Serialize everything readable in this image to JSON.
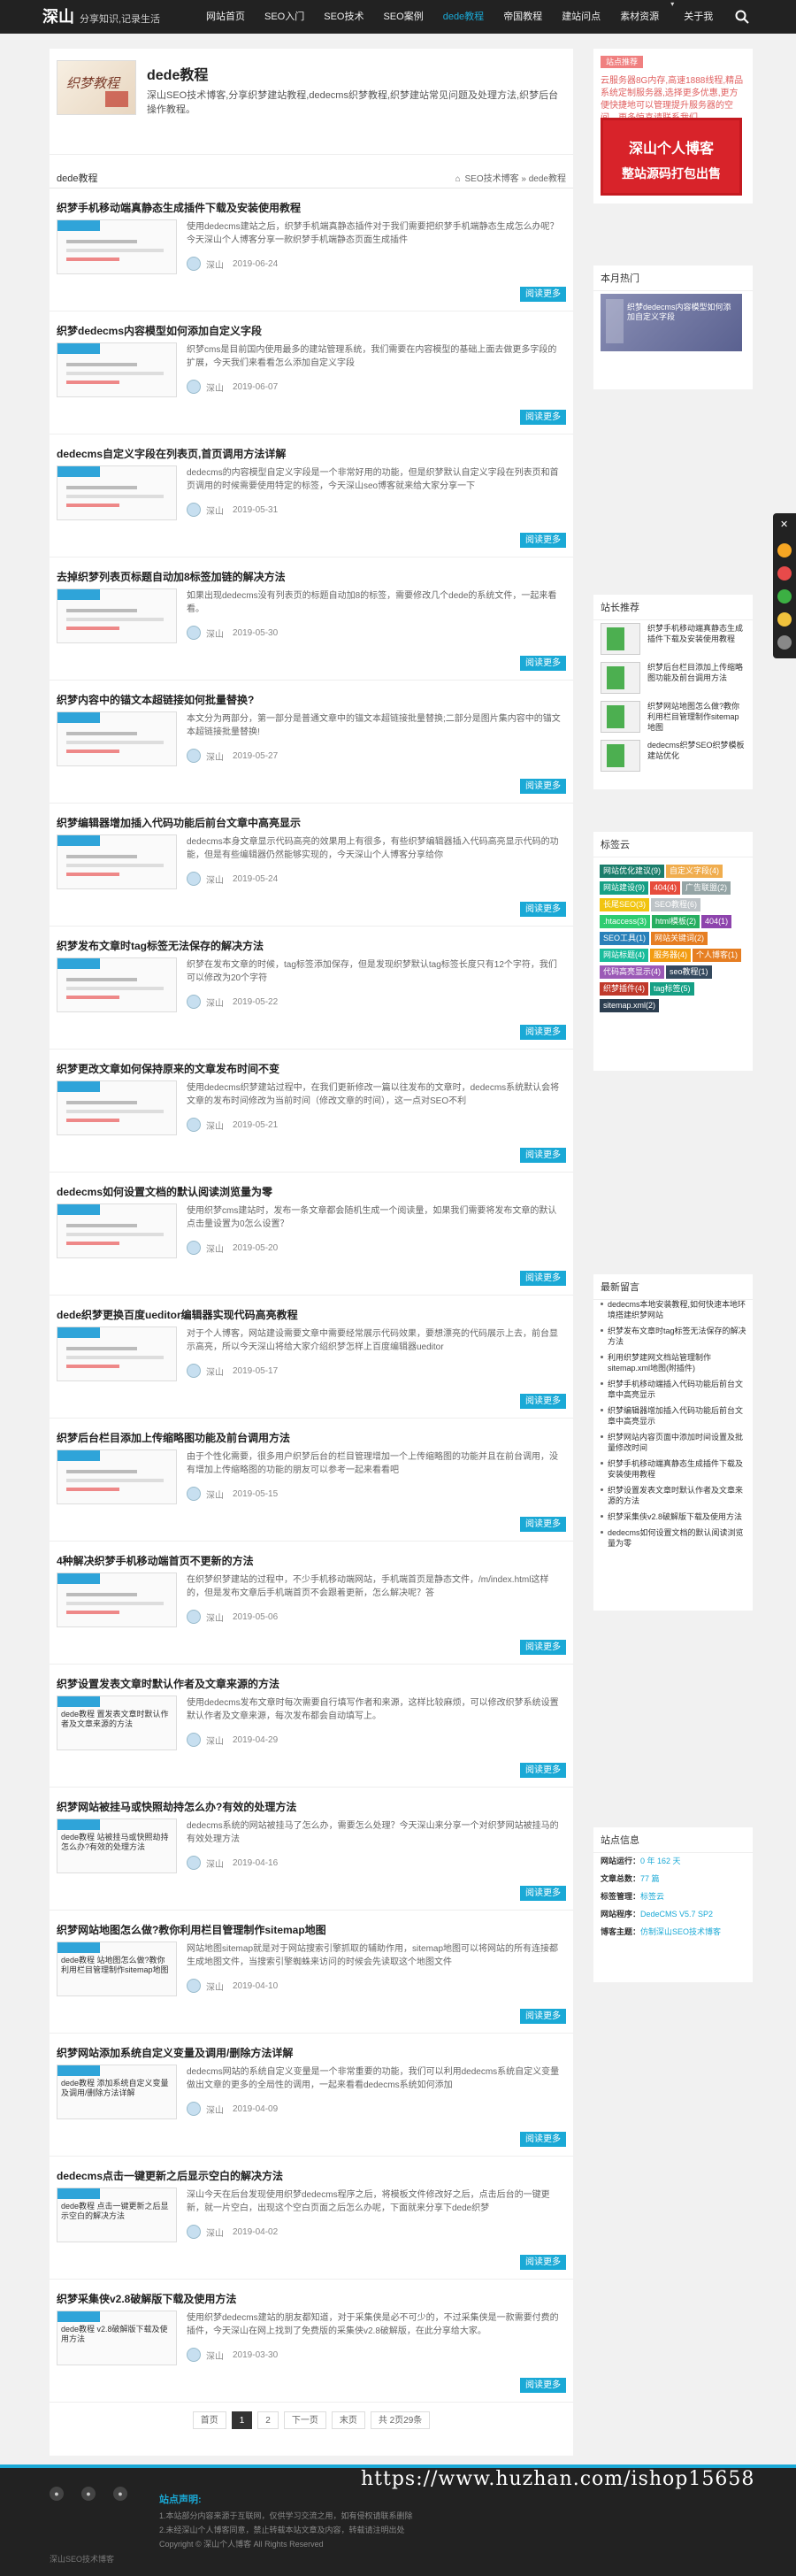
{
  "header": {
    "logo": "深山",
    "slogan": "分享知识,记录生活",
    "nav": [
      {
        "label": "网站首页",
        "active": false,
        "dropdown": false
      },
      {
        "label": "SEO入门",
        "active": false,
        "dropdown": false
      },
      {
        "label": "SEO技术",
        "active": false,
        "dropdown": false
      },
      {
        "label": "SEO案例",
        "active": false,
        "dropdown": false
      },
      {
        "label": "dede教程",
        "active": true,
        "dropdown": false
      },
      {
        "label": "帝国教程",
        "active": false,
        "dropdown": false
      },
      {
        "label": "建站问点",
        "active": false,
        "dropdown": false
      },
      {
        "label": "素材资源",
        "active": false,
        "dropdown": true
      },
      {
        "label": "关于我",
        "active": false,
        "dropdown": false
      }
    ],
    "search_icon": "search-icon"
  },
  "category": {
    "image_text": "织梦教程",
    "title": "dede教程",
    "description": "深山SEO技术博客,分享织梦建站教程,dedecms织梦教程,织梦建站常见问题及处理方法,织梦后台操作教程。"
  },
  "list_header": {
    "name": "dede教程",
    "breadcrumb": [
      "SEO技术博客",
      "dede教程"
    ],
    "breadcrumb_sep": "»"
  },
  "articles": [
    {
      "title": "织梦手机移动端真静态生成插件下载及安装使用教程",
      "excerpt": "使用dedecms建站之后，织梦手机端真静态插件对于我们需要把织梦手机端静态生成怎么办呢？今天深山个人博客分享一款织梦手机端静态页面生成插件",
      "author": "深山",
      "date": "2019-06-24",
      "read": "阅读更多",
      "thumb": true,
      "thumb_tag": "dede教程"
    },
    {
      "title": "织梦dedecms内容模型如何添加自定义字段",
      "excerpt": "织梦cms是目前国内使用最多的建站管理系统，我们需要在内容模型的基础上面去做更多字段的扩展，今天我们来看看怎么添加自定义字段",
      "author": "深山",
      "date": "2019-06-07",
      "read": "阅读更多",
      "thumb": true,
      "thumb_tag": "dede教程"
    },
    {
      "title": "dedecms自定义字段在列表页,首页调用方法详解",
      "excerpt": "dedecms的内容模型自定义字段是一个非常好用的功能，但是织梦默认自定义字段在列表页和首页调用的时候需要使用特定的标签，今天深山seo博客就来给大家分享一下",
      "author": "深山",
      "date": "2019-05-31",
      "read": "阅读更多",
      "thumb": true,
      "thumb_tag": "dede教程"
    },
    {
      "title": "去掉织梦列表页标题自动加8标签加链的解决方法",
      "excerpt": "如果出现dedecms没有列表页的标题自动加8的标签，需要修改几个dede的系统文件，一起来看看。",
      "author": "深山",
      "date": "2019-05-30",
      "read": "阅读更多",
      "thumb": true,
      "thumb_tag": "dede教程"
    },
    {
      "title": "织梦内容中的锚文本超链接如何批量替换?",
      "excerpt": "本文分为两部分，第一部分是普通文章中的锚文本超链接批量替换;二部分是图片集内容中的锚文本超链接批量替换!",
      "author": "深山",
      "date": "2019-05-27",
      "read": "阅读更多",
      "thumb": true,
      "thumb_tag": "dede教程"
    },
    {
      "title": "织梦编辑器增加插入代码功能后前台文章中高亮显示",
      "excerpt": "dedecms本身文章显示代码高亮的效果用上有很多，有些织梦编辑器插入代码高亮显示代码的功能，但是有些编辑器仍然能够实现的，今天深山个人博客分享给你",
      "author": "深山",
      "date": "2019-05-24",
      "read": "阅读更多",
      "thumb": true,
      "thumb_tag": "dede教程"
    },
    {
      "title": "织梦发布文章时tag标签无法保存的解决方法",
      "excerpt": "织梦在发布文章的时候，tag标签添加保存，但是发现织梦默认tag标签长度只有12个字符，我们可以修改为20个字符",
      "author": "深山",
      "date": "2019-05-22",
      "read": "阅读更多",
      "thumb": true,
      "thumb_tag": "dede教程"
    },
    {
      "title": "织梦更改文章如何保持原来的文章发布时间不变",
      "excerpt": "使用dedecms织梦建站过程中，在我们更新修改一篇以往发布的文章时，dedecms系统默认会将文章的发布时间修改为当前时间（修改文章的时间），这一点对SEO不利",
      "author": "深山",
      "date": "2019-05-21",
      "read": "阅读更多",
      "thumb": true,
      "thumb_tag": "dede教程"
    },
    {
      "title": "dedecms如何设置文档的默认阅读浏览量为零",
      "excerpt": "使用织梦cms建站时，发布一条文章都会随机生成一个阅读量，如果我们需要将发布文章的默认点击量设置为0怎么设置？",
      "author": "深山",
      "date": "2019-05-20",
      "read": "阅读更多",
      "thumb": true,
      "thumb_tag": "dede教程"
    },
    {
      "title": "dede织梦更换百度ueditor编辑器实现代码高亮教程",
      "excerpt": "对于个人博客，网站建设需要文章中需要经常展示代码效果，要想漂亮的代码展示上去，前台显示高亮，所以今天深山将给大家介绍织梦怎样上百度编辑器ueditor",
      "author": "深山",
      "date": "2019-05-17",
      "read": "阅读更多",
      "thumb": true,
      "thumb_tag": "dede教程"
    },
    {
      "title": "织梦后台栏目添加上传缩略图功能及前台调用方法",
      "excerpt": "由于个性化需要，很多用户织梦后台的栏目管理增加一个上传缩略图的功能并且在前台调用，没有增加上传缩略图的功能的朋友可以参考一起来看看吧",
      "author": "深山",
      "date": "2019-05-15",
      "read": "阅读更多",
      "thumb": true,
      "thumb_tag": "dede教程"
    },
    {
      "title": "4种解决织梦手机移动端首页不更新的方法",
      "excerpt": "在织梦织梦建站的过程中，不少手机移动端网站，手机端首页是静态文件，/m/index.html这样的，但是发布文章后手机端首页不会跟着更新，怎么解决呢？答",
      "author": "深山",
      "date": "2019-05-06",
      "read": "阅读更多",
      "thumb": true,
      "thumb_tag": "dede教程"
    },
    {
      "title": "织梦设置发表文章时默认作者及文章来源的方法",
      "excerpt": "使用dedecms发布文章时每次需要自行填写作者和来源，这样比较麻烦，可以修改织梦系统设置默认作者及文章来源，每次发布都会自动填写上。",
      "author": "深山",
      "date": "2019-04-29",
      "read": "阅读更多",
      "thumb": true,
      "thumb_tag": "dede教程",
      "thumb_text": "dede教程 置发表文章时默认作者及文章来源的方法"
    },
    {
      "title": "织梦网站被挂马或快照劫持怎么办?有效的处理方法",
      "excerpt": "dedecms系统的网站被挂马了怎么办，需要怎么处理？今天深山来分享一个对织梦网站被挂马的有效处理方法",
      "author": "深山",
      "date": "2019-04-16",
      "read": "阅读更多",
      "thumb": true,
      "thumb_tag": "dede教程",
      "thumb_text": "dede教程 站被挂马或快照劫持怎么办?有效的处理方法"
    },
    {
      "title": "织梦网站地图怎么做?教你利用栏目管理制作sitemap地图",
      "excerpt": "网站地图sitemap就是对于网站搜索引擎抓取的辅助作用，sitemap地图可以将网站的所有连接都生成地图文件，当搜索引擎蜘蛛来访问的时候会先读取这个地图文件",
      "author": "深山",
      "date": "2019-04-10",
      "read": "阅读更多",
      "thumb": true,
      "thumb_tag": "dede教程",
      "thumb_text": "dede教程 站地图怎么做?教你利用栏目管理制作sitemap地图"
    },
    {
      "title": "织梦网站添加系统自定义变量及调用/删除方法详解",
      "excerpt": "dedecms网站的系统自定义变量是一个非常重要的功能，我们可以利用dedecms系统自定义变量做出文章的更多的全局性的调用，一起来看看dedecms系统如何添加",
      "author": "深山",
      "date": "2019-04-09",
      "read": "阅读更多",
      "thumb": true,
      "thumb_tag": "dede教程",
      "thumb_text": "dede教程 添加系统自定义变量及调用/删除方法详解"
    },
    {
      "title": "dedecms点击一键更新之后显示空白的解决方法",
      "excerpt": "深山今天在后台发现使用织梦dedecms程序之后，将模板文件修改好之后，点击后台的一键更新，就一片空白，出现这个空白页面之后怎么办呢，下面就来分享下dede织梦",
      "author": "深山",
      "date": "2019-04-02",
      "read": "阅读更多",
      "thumb": true,
      "thumb_tag": "dede教程",
      "thumb_text": "dede教程 点击一键更新之后显示空白的解决方法"
    },
    {
      "title": "织梦采集侠v2.8破解版下载及使用方法",
      "excerpt": "使用织梦dedecms建站的朋友都知道，对于采集侠是必不可少的，不过采集侠是一款需要付费的插件，今天深山在网上找到了免费版的采集侠v2.8破解版，在此分享给大家。",
      "author": "深山",
      "date": "2019-03-30",
      "read": "阅读更多",
      "thumb": true,
      "thumb_tag": "dede教程",
      "thumb_text": "dede教程 v2.8破解版下载及使用方法"
    }
  ],
  "pagination": [
    "首页",
    "1",
    "2",
    "下一页",
    "末页",
    "共 2页29条"
  ],
  "sidebar": {
    "ad_tag": "站点推荐",
    "ad_text": "云服务器8G内存,高速1888线程,精品系统定制服务器,选择更多优惠,更方便快捷地可以管理提升服务器的空间，更多惊喜请联系我们",
    "banner_line1": "深山个人博客",
    "banner_line2": "整站源码打包出售",
    "hot_title": "本月热门",
    "hot_item": "织梦dedecms内容模型如何添加自定义字段",
    "recom_title": "站长推荐",
    "recom": [
      "织梦手机移动端真静态生成插件下载及安装使用教程",
      "织梦后台栏目添加上传缩略图功能及前台调用方法",
      "织梦网站地图怎么做?教你利用栏目管理制作sitemap地图",
      "dedecms织梦SEO织梦模板建站优化"
    ],
    "tags_title": "标签云",
    "tags": [
      {
        "t": "网站优化建议(9)",
        "c": "#1b7d6b"
      },
      {
        "t": "自定义字段(4)",
        "c": "#f0ad4e"
      },
      {
        "t": "网站建设(9)",
        "c": "#16a085"
      },
      {
        "t": "404(4)",
        "c": "#e74c3c"
      },
      {
        "t": "广告联盟(2)",
        "c": "#95a5a6"
      },
      {
        "t": "长尾SEO(3)",
        "c": "#f1c40f"
      },
      {
        "t": "SEO教程(6)",
        "c": "#bdc3c7"
      },
      {
        "t": ".htaccess(3)",
        "c": "#2ecc71"
      },
      {
        "t": "html模板(2)",
        "c": "#27ae60"
      },
      {
        "t": "404(1)",
        "c": "#8e44ad"
      },
      {
        "t": "SEO工具(1)",
        "c": "#2980b9"
      },
      {
        "t": "网站关键词(2)",
        "c": "#e67e22"
      },
      {
        "t": "网站标题(4)",
        "c": "#1abc9c"
      },
      {
        "t": "服务器(4)",
        "c": "#f39c12"
      },
      {
        "t": "个人博客(1)",
        "c": "#e67e22"
      },
      {
        "t": "代码高亮显示(4)",
        "c": "#9b59b6"
      },
      {
        "t": "seo教程(1)",
        "c": "#34495e"
      },
      {
        "t": "织梦插件(4)",
        "c": "#c0392b"
      },
      {
        "t": "tag标签(5)",
        "c": "#16a085"
      },
      {
        "t": "sitemap.xml(2)",
        "c": "#2c3e50"
      }
    ],
    "comment_title": "最新留言",
    "comments": [
      "dedecms本地安装教程,如何快速本地环境搭建织梦网站",
      "织梦发布文章时tag标签无法保存的解决方法",
      "利用织梦建网文档站管理制作sitemap.xml地图(附插件)",
      "织梦手机移动端插入代码功能后前台文章中高亮显示",
      "织梦编辑器增加插入代码功能后前台文章中高亮显示",
      "织梦网站内容页面中添加时间设置及批量修改时间",
      "织梦手机移动端真静态生成插件下载及安装使用教程",
      "织梦设置发表文章时默认作者及文章来源的方法",
      "织梦采集侠v2.8破解版下载及使用方法",
      "dedecms如何设置文档的默认阅读浏览量为零"
    ],
    "stats_title": "站点信息",
    "stats": [
      {
        "k": "网站运行：",
        "v": "0 年 162 天"
      },
      {
        "k": "文章总数：",
        "v": "77 篇"
      },
      {
        "k": "标签管理：",
        "v": "标签云"
      },
      {
        "k": "网站程序：",
        "v": "DedeCMS V5.7 SP2"
      },
      {
        "k": "博客主题：",
        "v": "仿制深山SEO技术博客"
      }
    ]
  },
  "footer": {
    "watermark": "https://www.huzhan.com/ishop15658",
    "title": "站点声明:",
    "lines": [
      "1.本站部分内容来源于互联网，仅供学习交流之用，如有侵权请联系删除",
      "2.未经深山个人博客同意，禁止转载本站文章及内容，转载请注明出处",
      "Copyright © 深山个人博客 All Rights Reserved"
    ],
    "left": "深山SEO技术博客"
  },
  "colors": {
    "accent": "#1aa9d6",
    "header_bg": "#222222",
    "banner": "#d8232a"
  }
}
